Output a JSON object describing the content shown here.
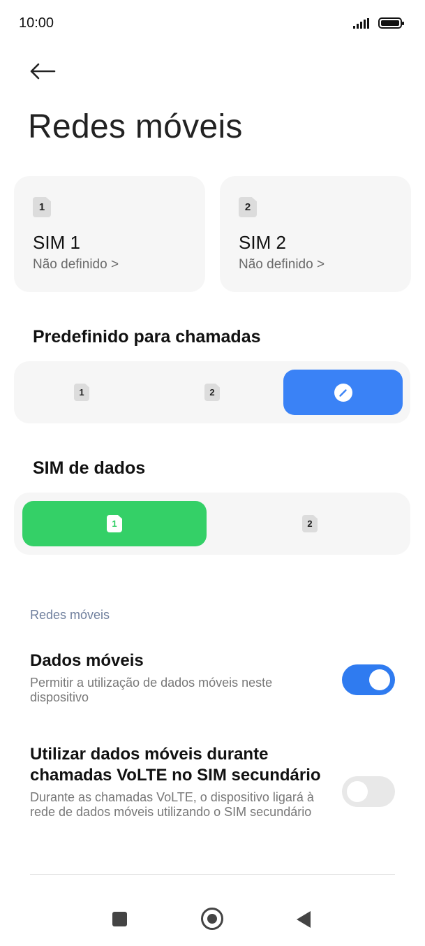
{
  "status_bar": {
    "time": "10:00"
  },
  "header": {
    "title": "Redes móveis"
  },
  "sims": [
    {
      "badge": "1",
      "name": "SIM 1",
      "status": "Não definido >"
    },
    {
      "badge": "2",
      "name": "SIM 2",
      "status": "Não definido >"
    }
  ],
  "calls": {
    "heading": "Predefinido para chamadas",
    "options": [
      {
        "badge": "1"
      },
      {
        "badge": "2"
      }
    ]
  },
  "data_sim": {
    "heading": "SIM de dados",
    "options": [
      {
        "badge": "1"
      },
      {
        "badge": "2"
      }
    ]
  },
  "section": {
    "label": "Redes móveis"
  },
  "settings": [
    {
      "title": "Dados móveis",
      "description": "Permitir a utilização de dados móveis neste dispositivo",
      "enabled": true
    },
    {
      "title": "Utilizar dados móveis durante chamadas VoLTE no SIM secundário",
      "description": "Durante as chamadas VoLTE, o dispositivo ligará à rede de dados móveis utilizando o SIM secundário",
      "enabled": false
    }
  ],
  "colors": {
    "accent_blue": "#3a82f6",
    "accent_green": "#34d067",
    "toggle_on": "#2f7bf0"
  },
  "icons": [
    "back-arrow-icon",
    "signal-icon",
    "battery-icon",
    "sim-icon",
    "pen-icon",
    "square-nav-icon",
    "home-nav-icon",
    "back-nav-icon"
  ]
}
